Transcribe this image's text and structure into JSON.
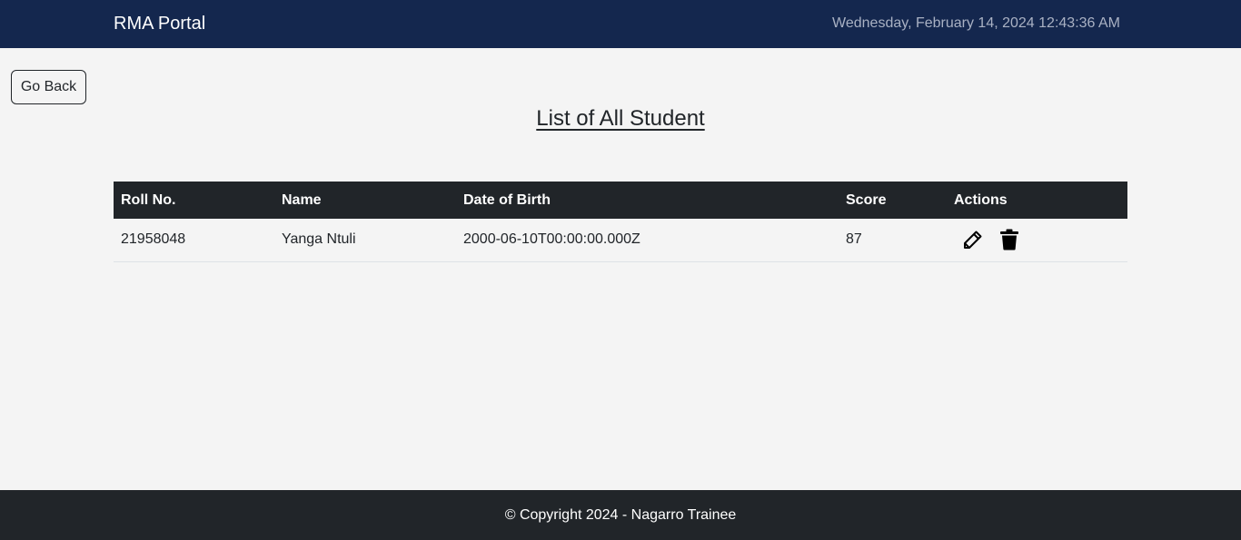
{
  "navbar": {
    "brand": "RMA Portal",
    "datetime": "Wednesday, February 14, 2024 12:43:36 AM",
    "background_color": "#14274e"
  },
  "back_button": {
    "label": "Go Back"
  },
  "page": {
    "title": "List of All Student"
  },
  "table": {
    "headers": {
      "roll": "Roll No.",
      "name": "Name",
      "dob": "Date of Birth",
      "score": "Score",
      "actions": "Actions"
    },
    "rows": [
      {
        "roll": "21958048",
        "name": "Yanga Ntuli",
        "dob": "2000-06-10T00:00:00.000Z",
        "score": "87",
        "actions": [
          "pencil-icon",
          "trash-icon"
        ]
      }
    ]
  },
  "footer": {
    "text": "© Copyright 2024 - Nagarro Trainee",
    "background_color": "#212529"
  }
}
